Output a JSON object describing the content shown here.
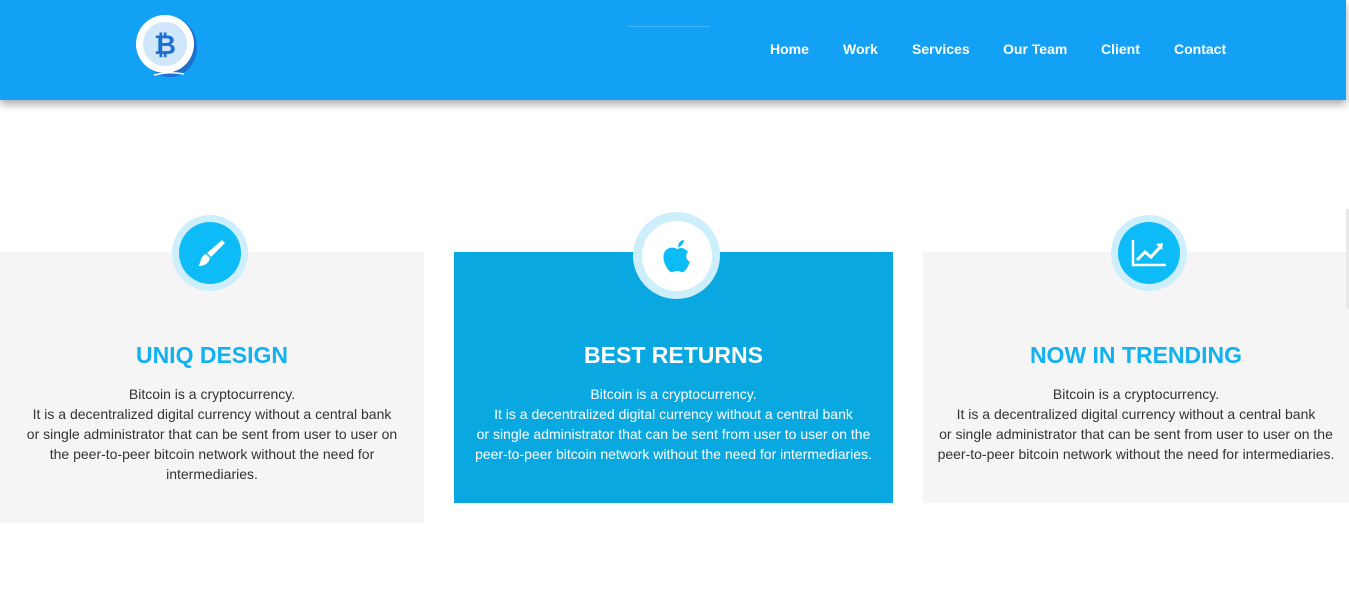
{
  "nav": {
    "links": [
      "Home",
      "Work",
      "Services",
      "Our Team",
      "Client",
      "Contact"
    ]
  },
  "logo": {
    "icon": "bitcoin-icon",
    "symbol": "₿"
  },
  "colors": {
    "navbar": "#12a1f4",
    "accent": "#0dbbf7",
    "highlight_card": "#0aa8e1",
    "card_bg": "#f5f5f5",
    "title_blue": "#12b1ef"
  },
  "features": [
    {
      "icon": "paintbrush-icon",
      "title": "UNIQ DESIGN",
      "lines": [
        "Bitcoin is a cryptocurrency.",
        "It is a decentralized digital currency without a central bank",
        "or single administrator that can be sent from user to user on",
        "the peer-to-peer bitcoin network without the need for",
        "intermediaries."
      ]
    },
    {
      "icon": "apple-icon",
      "title": "BEST RETURNS",
      "lines": [
        "Bitcoin is a cryptocurrency.",
        "It is a decentralized digital currency without a central bank",
        "or single administrator that can be sent from user to user on the",
        "peer-to-peer bitcoin network without the need for intermediaries."
      ]
    },
    {
      "icon": "line-chart-icon",
      "title": "NOW IN TRENDING",
      "lines": [
        "Bitcoin is a cryptocurrency.",
        "It is a decentralized digital currency without a central bank",
        "or single administrator that can be sent from user to user on the",
        "peer-to-peer bitcoin network without the need for intermediaries."
      ]
    }
  ]
}
